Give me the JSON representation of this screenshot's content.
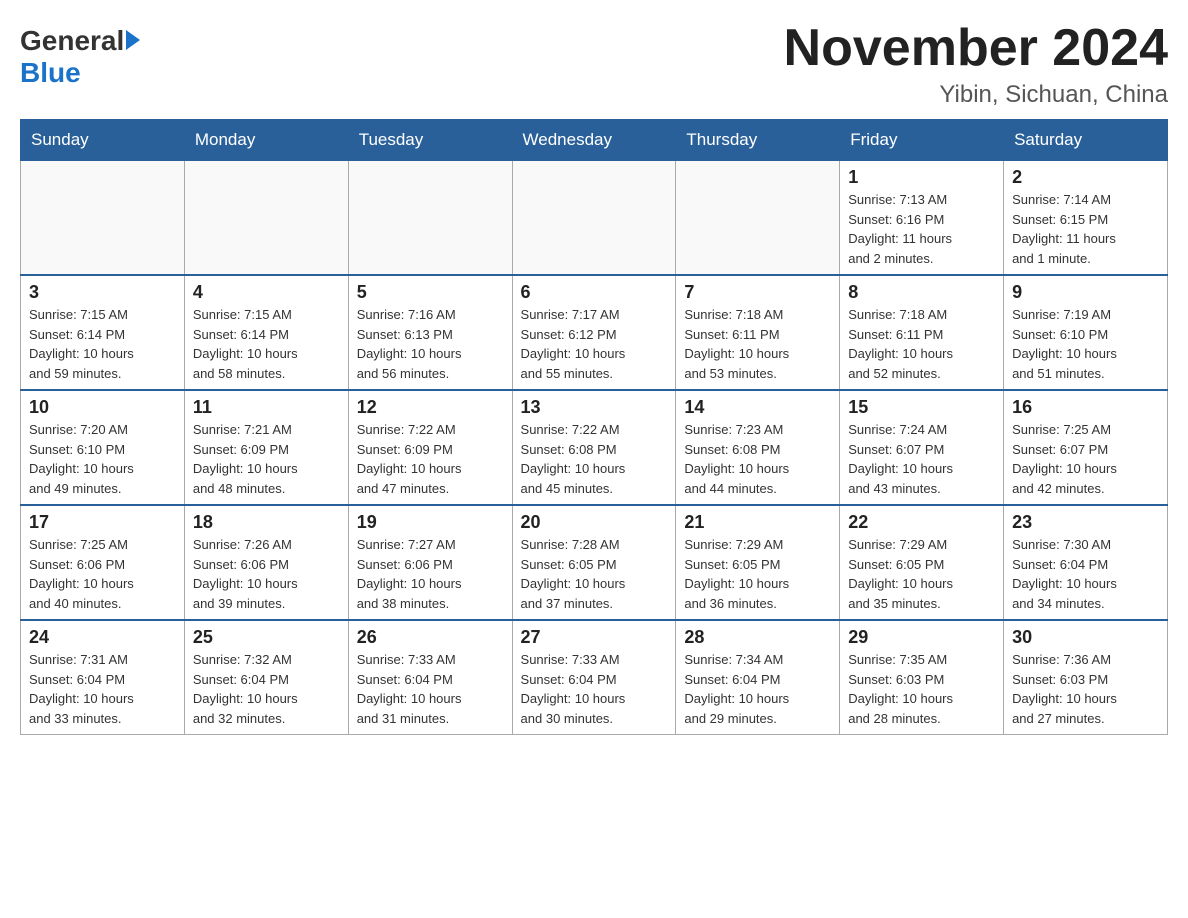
{
  "header": {
    "logo_general": "General",
    "logo_blue": "Blue",
    "month_title": "November 2024",
    "subtitle": "Yibin, Sichuan, China"
  },
  "days_of_week": [
    "Sunday",
    "Monday",
    "Tuesday",
    "Wednesday",
    "Thursday",
    "Friday",
    "Saturday"
  ],
  "weeks": [
    {
      "days": [
        {
          "num": "",
          "info": ""
        },
        {
          "num": "",
          "info": ""
        },
        {
          "num": "",
          "info": ""
        },
        {
          "num": "",
          "info": ""
        },
        {
          "num": "",
          "info": ""
        },
        {
          "num": "1",
          "info": "Sunrise: 7:13 AM\nSunset: 6:16 PM\nDaylight: 11 hours\nand 2 minutes."
        },
        {
          "num": "2",
          "info": "Sunrise: 7:14 AM\nSunset: 6:15 PM\nDaylight: 11 hours\nand 1 minute."
        }
      ]
    },
    {
      "days": [
        {
          "num": "3",
          "info": "Sunrise: 7:15 AM\nSunset: 6:14 PM\nDaylight: 10 hours\nand 59 minutes."
        },
        {
          "num": "4",
          "info": "Sunrise: 7:15 AM\nSunset: 6:14 PM\nDaylight: 10 hours\nand 58 minutes."
        },
        {
          "num": "5",
          "info": "Sunrise: 7:16 AM\nSunset: 6:13 PM\nDaylight: 10 hours\nand 56 minutes."
        },
        {
          "num": "6",
          "info": "Sunrise: 7:17 AM\nSunset: 6:12 PM\nDaylight: 10 hours\nand 55 minutes."
        },
        {
          "num": "7",
          "info": "Sunrise: 7:18 AM\nSunset: 6:11 PM\nDaylight: 10 hours\nand 53 minutes."
        },
        {
          "num": "8",
          "info": "Sunrise: 7:18 AM\nSunset: 6:11 PM\nDaylight: 10 hours\nand 52 minutes."
        },
        {
          "num": "9",
          "info": "Sunrise: 7:19 AM\nSunset: 6:10 PM\nDaylight: 10 hours\nand 51 minutes."
        }
      ]
    },
    {
      "days": [
        {
          "num": "10",
          "info": "Sunrise: 7:20 AM\nSunset: 6:10 PM\nDaylight: 10 hours\nand 49 minutes."
        },
        {
          "num": "11",
          "info": "Sunrise: 7:21 AM\nSunset: 6:09 PM\nDaylight: 10 hours\nand 48 minutes."
        },
        {
          "num": "12",
          "info": "Sunrise: 7:22 AM\nSunset: 6:09 PM\nDaylight: 10 hours\nand 47 minutes."
        },
        {
          "num": "13",
          "info": "Sunrise: 7:22 AM\nSunset: 6:08 PM\nDaylight: 10 hours\nand 45 minutes."
        },
        {
          "num": "14",
          "info": "Sunrise: 7:23 AM\nSunset: 6:08 PM\nDaylight: 10 hours\nand 44 minutes."
        },
        {
          "num": "15",
          "info": "Sunrise: 7:24 AM\nSunset: 6:07 PM\nDaylight: 10 hours\nand 43 minutes."
        },
        {
          "num": "16",
          "info": "Sunrise: 7:25 AM\nSunset: 6:07 PM\nDaylight: 10 hours\nand 42 minutes."
        }
      ]
    },
    {
      "days": [
        {
          "num": "17",
          "info": "Sunrise: 7:25 AM\nSunset: 6:06 PM\nDaylight: 10 hours\nand 40 minutes."
        },
        {
          "num": "18",
          "info": "Sunrise: 7:26 AM\nSunset: 6:06 PM\nDaylight: 10 hours\nand 39 minutes."
        },
        {
          "num": "19",
          "info": "Sunrise: 7:27 AM\nSunset: 6:06 PM\nDaylight: 10 hours\nand 38 minutes."
        },
        {
          "num": "20",
          "info": "Sunrise: 7:28 AM\nSunset: 6:05 PM\nDaylight: 10 hours\nand 37 minutes."
        },
        {
          "num": "21",
          "info": "Sunrise: 7:29 AM\nSunset: 6:05 PM\nDaylight: 10 hours\nand 36 minutes."
        },
        {
          "num": "22",
          "info": "Sunrise: 7:29 AM\nSunset: 6:05 PM\nDaylight: 10 hours\nand 35 minutes."
        },
        {
          "num": "23",
          "info": "Sunrise: 7:30 AM\nSunset: 6:04 PM\nDaylight: 10 hours\nand 34 minutes."
        }
      ]
    },
    {
      "days": [
        {
          "num": "24",
          "info": "Sunrise: 7:31 AM\nSunset: 6:04 PM\nDaylight: 10 hours\nand 33 minutes."
        },
        {
          "num": "25",
          "info": "Sunrise: 7:32 AM\nSunset: 6:04 PM\nDaylight: 10 hours\nand 32 minutes."
        },
        {
          "num": "26",
          "info": "Sunrise: 7:33 AM\nSunset: 6:04 PM\nDaylight: 10 hours\nand 31 minutes."
        },
        {
          "num": "27",
          "info": "Sunrise: 7:33 AM\nSunset: 6:04 PM\nDaylight: 10 hours\nand 30 minutes."
        },
        {
          "num": "28",
          "info": "Sunrise: 7:34 AM\nSunset: 6:04 PM\nDaylight: 10 hours\nand 29 minutes."
        },
        {
          "num": "29",
          "info": "Sunrise: 7:35 AM\nSunset: 6:03 PM\nDaylight: 10 hours\nand 28 minutes."
        },
        {
          "num": "30",
          "info": "Sunrise: 7:36 AM\nSunset: 6:03 PM\nDaylight: 10 hours\nand 27 minutes."
        }
      ]
    }
  ]
}
